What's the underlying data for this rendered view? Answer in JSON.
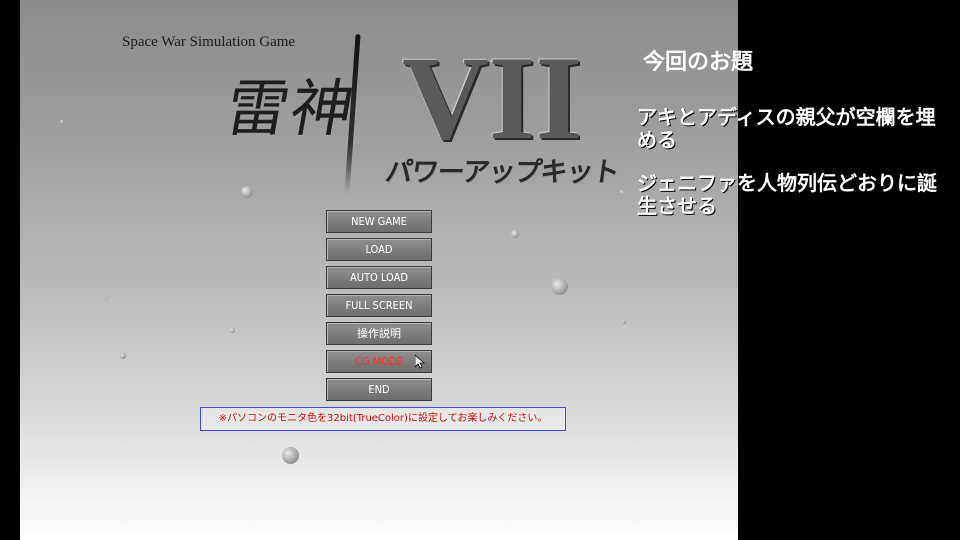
{
  "game": {
    "subtitle": "Space War Simulation Game",
    "title_kanji": "雷神",
    "title_numeral": "VII",
    "title_sub": "パワーアップキット",
    "menu": [
      {
        "label": "NEW GAME",
        "active": false
      },
      {
        "label": "LOAD",
        "active": false
      },
      {
        "label": "AUTO LOAD",
        "active": false
      },
      {
        "label": "FULL SCREEN",
        "active": false
      },
      {
        "label": "操作説明",
        "active": false
      },
      {
        "label": "CG MODE",
        "active": true
      },
      {
        "label": "END",
        "active": false
      }
    ],
    "notice": "※パソコンのモニタ色を32bit(TrueColor)に設定してお楽しみください。"
  },
  "overlay": {
    "heading": "今回のお題",
    "items": [
      "アキとアディスの親父が空欄を埋める",
      "ジェニファを人物列伝どおりに誕生させる"
    ]
  },
  "colors": {
    "active_menu_text": "#ff2a2a",
    "notice_text": "#d01010",
    "notice_border": "#4a4ad0"
  },
  "icons": [
    "mouse-cursor-icon"
  ]
}
